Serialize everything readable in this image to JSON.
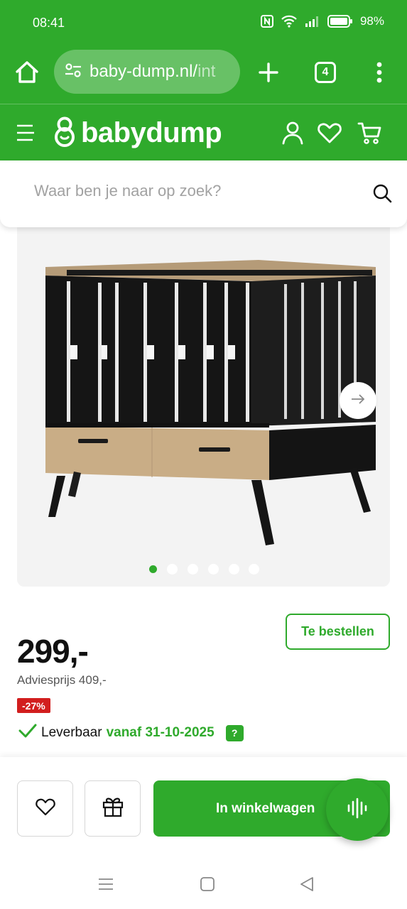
{
  "status_bar": {
    "time": "08:41",
    "battery": "98%",
    "icons": [
      "nfc-icon",
      "wifi-icon",
      "signal-icon",
      "battery-icon"
    ]
  },
  "browser": {
    "url_main": "baby-dump.nl/",
    "url_faded": "int",
    "tab_count": "4",
    "icons": [
      "home-icon",
      "site-settings-icon",
      "plus-icon",
      "tabs-icon",
      "overflow-menu-icon"
    ]
  },
  "site_header": {
    "logo_text": "babydump",
    "icons": [
      "hamburger-icon",
      "account-icon",
      "heart-icon",
      "cart-icon"
    ]
  },
  "search": {
    "placeholder": "Waar ben je naar op zoek?",
    "value": ""
  },
  "gallery": {
    "image_count": 6,
    "active_index": 0
  },
  "product": {
    "order_label": "Te bestellen",
    "price": "299,-",
    "advice_price": "Adviesprijs 409,-",
    "discount": "-27%",
    "availability_label": "Leverbaar",
    "availability_date": "vanaf 31-10-2025",
    "help": "?"
  },
  "actions": {
    "add_to_cart": "In winkelwagen"
  },
  "colors": {
    "brand_green": "#2faa2c",
    "discount_red": "#d21e1e"
  }
}
